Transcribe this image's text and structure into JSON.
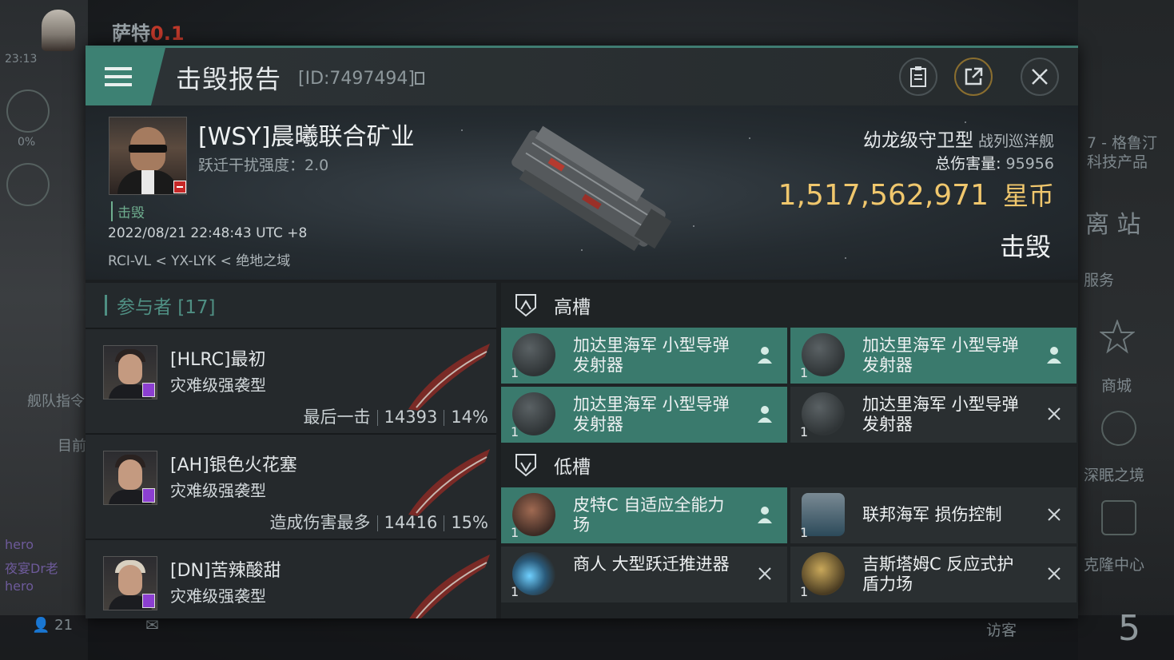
{
  "background": {
    "pilot_name": "萨特",
    "security": "0.1",
    "time": "23:13",
    "percent": "0%",
    "fleet_label": "舰队指令",
    "current_label": "目前",
    "system_label": "7 - 格鲁汀",
    "tech_label": "科技产品",
    "undock": "离 站",
    "services": "服务",
    "store": "商城",
    "deep_sleep": "深眠之境",
    "clone": "克隆中心",
    "visitors": "访客",
    "local_count": "21",
    "counter": "5",
    "chat_lines": [
      "hero",
      "夜宴Dr老",
      "hero"
    ]
  },
  "modal": {
    "title": "击毁报告",
    "report_id": "[ID:7497494]",
    "victim": {
      "name": "[WSY]晨曦联合矿业",
      "warp_label": "跃迁干扰强度：2.0",
      "status_tag": "击毁",
      "datetime": "2022/08/21 22:48:43 UTC +8",
      "location": "RCI-VL < YX-LYK < 绝地之域"
    },
    "ship": {
      "name": "幼龙级守卫型",
      "class": "战列巡洋舰",
      "damage_label": "总伤害量:",
      "damage_value": "95956",
      "isk_value": "1,517,562,971",
      "isk_unit": "星币",
      "result": "击毁"
    },
    "participants": {
      "header": "参与者 [17]",
      "rows": [
        {
          "name": "[HLRC]最初",
          "ship": "灾难级强袭型",
          "label": "最后一击",
          "damage": "14393",
          "pct": "14%"
        },
        {
          "name": "[AH]银色火花塞",
          "ship": "灾难级强袭型",
          "label": "造成伤害最多",
          "damage": "14416",
          "pct": "15%"
        },
        {
          "name": "[DN]苦辣酸甜",
          "ship": "灾难级强袭型",
          "label": "",
          "damage": "",
          "pct": ""
        }
      ]
    },
    "high_slots": {
      "header": "高槽",
      "items": [
        {
          "name": "加达里海军 小型导弹发射器",
          "qty": "1",
          "state": "dropped"
        },
        {
          "name": "加达里海军 小型导弹发射器",
          "qty": "1",
          "state": "dropped"
        },
        {
          "name": "加达里海军 小型导弹发射器",
          "qty": "1",
          "state": "dropped"
        },
        {
          "name": "加达里海军 小型导弹发射器",
          "qty": "1",
          "state": "destroyed"
        }
      ]
    },
    "low_slots": {
      "header": "低槽",
      "items": [
        {
          "name": "皮特C 自适应全能力场",
          "qty": "1",
          "state": "dropped"
        },
        {
          "name": "联邦海军 损伤控制",
          "qty": "1",
          "state": "destroyed"
        },
        {
          "name": "商人 大型跃迁推进器",
          "qty": "1",
          "state": "destroyed"
        },
        {
          "name": "吉斯塔姆C 反应式护盾力场",
          "qty": "1",
          "state": "destroyed"
        }
      ]
    },
    "colors": {
      "accent": "#3d8173",
      "isk": "#f0c76d",
      "highlight": "#3a7a6d"
    }
  }
}
